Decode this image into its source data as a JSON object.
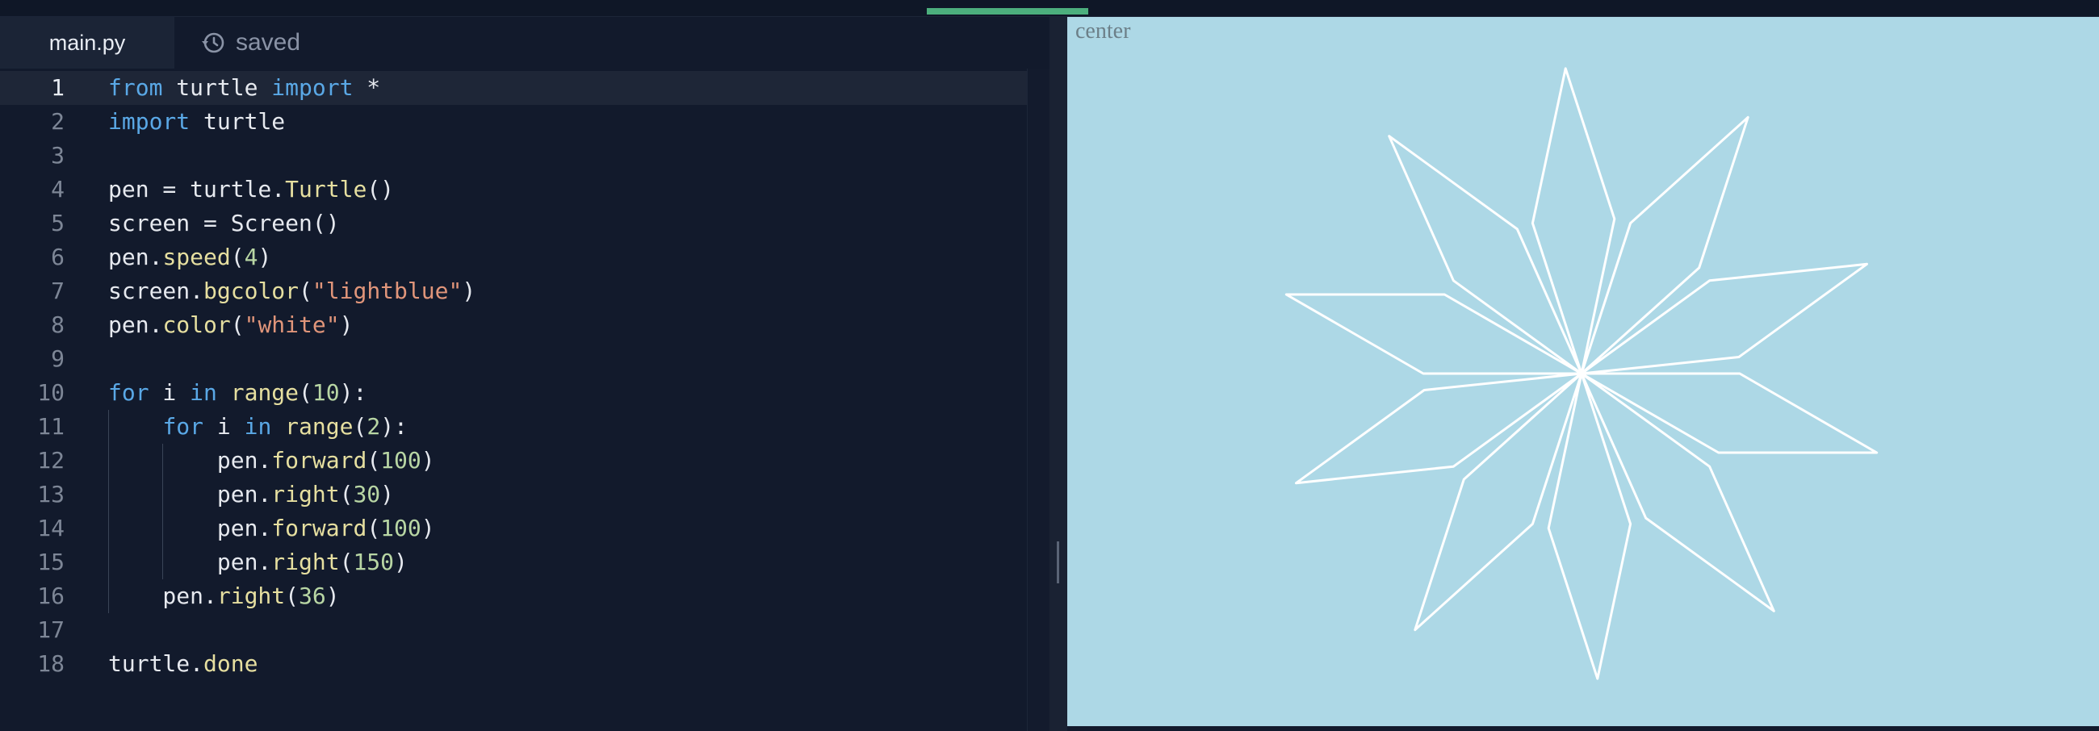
{
  "editor": {
    "active_tab": "main.py",
    "save_status": "saved",
    "cursor_line": 1,
    "lines": [
      {
        "n": "1",
        "tokens": [
          [
            "kw",
            "from"
          ],
          [
            "p",
            " turtle "
          ],
          [
            "kw",
            "import"
          ],
          [
            "p",
            " *"
          ]
        ]
      },
      {
        "n": "2",
        "tokens": [
          [
            "kw",
            "import"
          ],
          [
            "p",
            " turtle"
          ]
        ]
      },
      {
        "n": "3",
        "tokens": []
      },
      {
        "n": "4",
        "tokens": [
          [
            "p",
            "pen = turtle."
          ],
          [
            "fn",
            "Turtle"
          ],
          [
            "p",
            "()"
          ]
        ]
      },
      {
        "n": "5",
        "tokens": [
          [
            "p",
            "screen = Screen()"
          ]
        ]
      },
      {
        "n": "6",
        "tokens": [
          [
            "p",
            "pen."
          ],
          [
            "fn",
            "speed"
          ],
          [
            "p",
            "("
          ],
          [
            "num",
            "4"
          ],
          [
            "p",
            ")"
          ]
        ]
      },
      {
        "n": "7",
        "tokens": [
          [
            "p",
            "screen."
          ],
          [
            "fn",
            "bgcolor"
          ],
          [
            "p",
            "("
          ],
          [
            "str",
            "\"lightblue\""
          ],
          [
            "p",
            ")"
          ]
        ]
      },
      {
        "n": "8",
        "tokens": [
          [
            "p",
            "pen."
          ],
          [
            "fn",
            "color"
          ],
          [
            "p",
            "("
          ],
          [
            "str",
            "\"white\""
          ],
          [
            "p",
            ")"
          ]
        ]
      },
      {
        "n": "9",
        "tokens": []
      },
      {
        "n": "10",
        "tokens": [
          [
            "kw",
            "for"
          ],
          [
            "p",
            " i "
          ],
          [
            "kw",
            "in"
          ],
          [
            "p",
            " "
          ],
          [
            "fn",
            "range"
          ],
          [
            "p",
            "("
          ],
          [
            "num",
            "10"
          ],
          [
            "p",
            "):"
          ]
        ]
      },
      {
        "n": "11",
        "tokens": [
          [
            "p",
            "    "
          ],
          [
            "kw",
            "for"
          ],
          [
            "p",
            " i "
          ],
          [
            "kw",
            "in"
          ],
          [
            "p",
            " "
          ],
          [
            "fn",
            "range"
          ],
          [
            "p",
            "("
          ],
          [
            "num",
            "2"
          ],
          [
            "p",
            "):"
          ]
        ]
      },
      {
        "n": "12",
        "tokens": [
          [
            "p",
            "        pen."
          ],
          [
            "fn",
            "forward"
          ],
          [
            "p",
            "("
          ],
          [
            "num",
            "100"
          ],
          [
            "p",
            ")"
          ]
        ]
      },
      {
        "n": "13",
        "tokens": [
          [
            "p",
            "        pen."
          ],
          [
            "fn",
            "right"
          ],
          [
            "p",
            "("
          ],
          [
            "num",
            "30"
          ],
          [
            "p",
            ")"
          ]
        ]
      },
      {
        "n": "14",
        "tokens": [
          [
            "p",
            "        pen."
          ],
          [
            "fn",
            "forward"
          ],
          [
            "p",
            "("
          ],
          [
            "num",
            "100"
          ],
          [
            "p",
            ")"
          ]
        ]
      },
      {
        "n": "15",
        "tokens": [
          [
            "p",
            "        pen."
          ],
          [
            "fn",
            "right"
          ],
          [
            "p",
            "("
          ],
          [
            "num",
            "150"
          ],
          [
            "p",
            ")"
          ]
        ]
      },
      {
        "n": "16",
        "tokens": [
          [
            "p",
            "    pen."
          ],
          [
            "fn",
            "right"
          ],
          [
            "p",
            "("
          ],
          [
            "num",
            "36"
          ],
          [
            "p",
            ")"
          ]
        ]
      },
      {
        "n": "17",
        "tokens": []
      },
      {
        "n": "18",
        "tokens": [
          [
            "p",
            "turtle."
          ],
          [
            "fn",
            "done"
          ]
        ]
      }
    ]
  },
  "output": {
    "label": "center",
    "background": "#add8e6",
    "pen_color": "#ffffff",
    "drawing": {
      "shape": "star of 10 rhombi",
      "petals": 10,
      "side": 100,
      "inner_angle": 30,
      "turn": 36
    }
  },
  "colors": {
    "editor_bg": "#121a2c",
    "accent_progress": "#4caf7d",
    "keyword": "#5aa8e6",
    "function": "#e6dfa0",
    "number": "#b8d6a4",
    "string": "#e0957a"
  }
}
